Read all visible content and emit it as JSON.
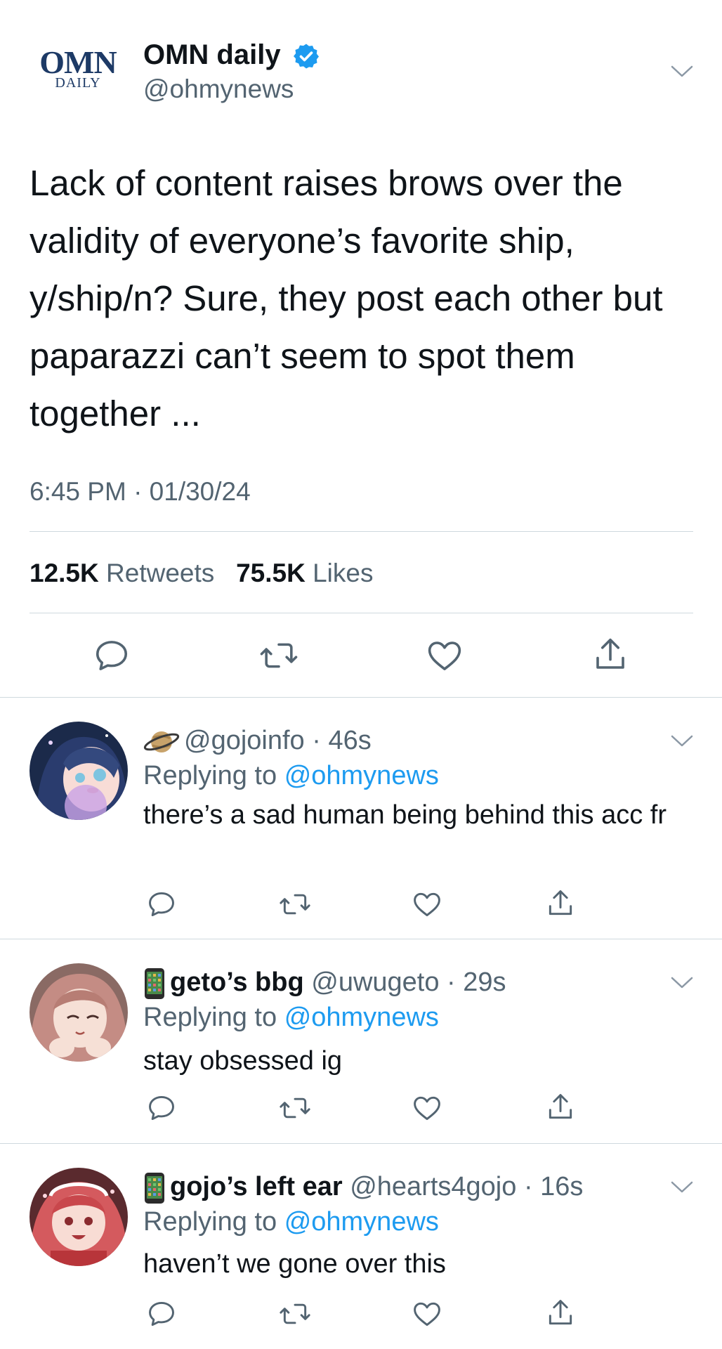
{
  "tweet": {
    "logo_main": "OMN",
    "logo_sub": "DAILY",
    "author_name": "OMN daily",
    "author_handle": "@ohmynews",
    "text": "Lack of content raises brows over the validity of everyone’s favorite ship, y/ship/n? Sure, they post each other but paparazzi can’t seem to spot them together ...",
    "timestamp": "6:45 PM · 01/30/24",
    "retweets_count": "12.5K",
    "retweets_label": "Retweets",
    "likes_count": "75.5K",
    "likes_label": "Likes"
  },
  "replies": [
    {
      "emoji_icon": "planet-icon",
      "name": "",
      "meta": "@gojoinfo · 46s",
      "replying_prefix": "Replying to",
      "replying_handle": "@ohmynews",
      "text": "there’s a sad human being behind this acc fr"
    },
    {
      "emoji_icon": "phone-icon",
      "name": "geto’s bbg",
      "meta": " @uwugeto · 29s",
      "replying_prefix": "Replying to",
      "replying_handle": "@ohmynews",
      "text": "stay obsessed ig"
    },
    {
      "emoji_icon": "phone-icon",
      "name": "gojo’s left ear",
      "meta": " @hearts4gojo · 16s",
      "replying_prefix": "Replying to",
      "replying_handle": "@ohmynews",
      "text": "haven’t we gone over this"
    }
  ],
  "colors": {
    "accent": "#1d9bf0",
    "secondary_text": "#536471",
    "divider": "#cfd9de",
    "logo": "#1d3a66"
  }
}
